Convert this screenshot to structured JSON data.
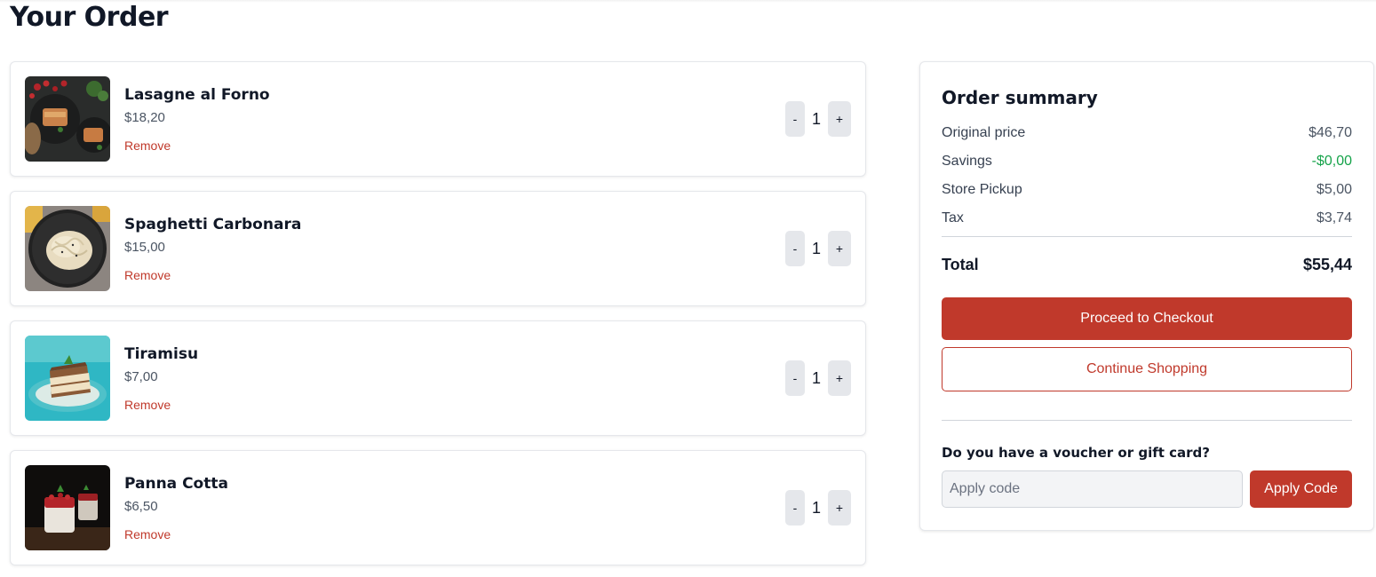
{
  "page": {
    "title": "Your Order"
  },
  "cart": {
    "items": [
      {
        "name": "Lasagne al Forno",
        "price": "$18,20",
        "remove_label": "Remove",
        "quantity": "1",
        "decrease_label": "-",
        "increase_label": "+",
        "image": "lasagne-photo"
      },
      {
        "name": "Spaghetti Carbonara",
        "price": "$15,00",
        "remove_label": "Remove",
        "quantity": "1",
        "decrease_label": "-",
        "increase_label": "+",
        "image": "spaghetti-photo"
      },
      {
        "name": "Tiramisu",
        "price": "$7,00",
        "remove_label": "Remove",
        "quantity": "1",
        "decrease_label": "-",
        "increase_label": "+",
        "image": "tiramisu-photo"
      },
      {
        "name": "Panna Cotta",
        "price": "$6,50",
        "remove_label": "Remove",
        "quantity": "1",
        "decrease_label": "-",
        "increase_label": "+",
        "image": "panna-cotta-photo"
      }
    ]
  },
  "summary": {
    "title": "Order summary",
    "rows": [
      {
        "label": "Original price",
        "value": "$46,70"
      },
      {
        "label": "Savings",
        "value": "-$0,00"
      },
      {
        "label": "Store Pickup",
        "value": "$5,00"
      },
      {
        "label": "Tax",
        "value": "$3,74"
      }
    ],
    "total_label": "Total",
    "total_value": "$55,44",
    "checkout_label": "Proceed to Checkout",
    "continue_label": "Continue Shopping",
    "voucher_question": "Do you have a voucher or gift card?",
    "code_placeholder": "Apply code",
    "apply_label": "Apply Code"
  },
  "colors": {
    "accent": "#c0392b",
    "savings": "#16a34a"
  }
}
